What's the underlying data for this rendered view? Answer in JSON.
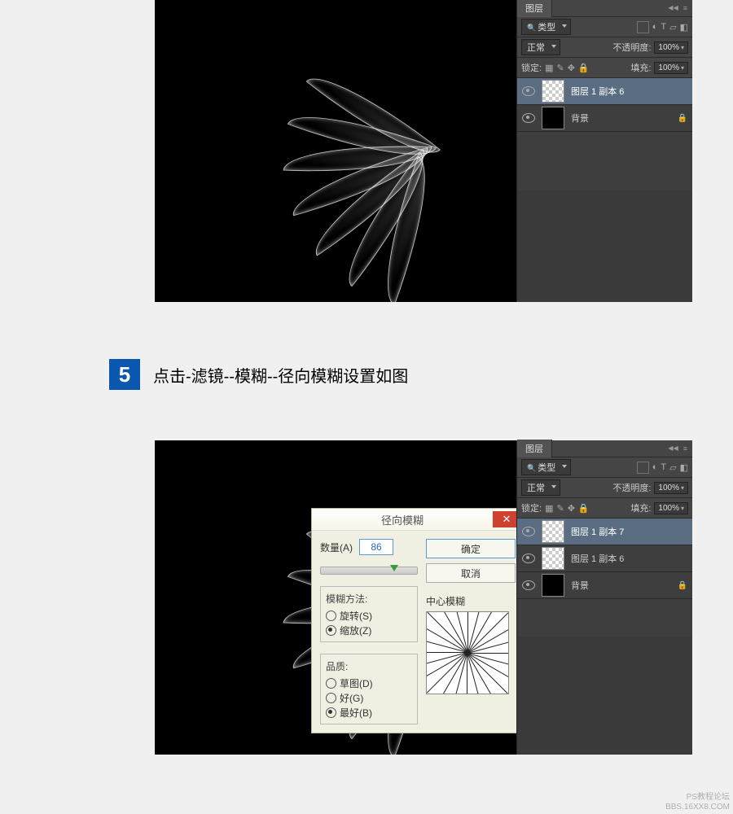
{
  "step": {
    "number": "5",
    "text": "点击-滤镜--模糊--径向模糊设置如图"
  },
  "panel1": {
    "tab": "图层",
    "filter": "类型",
    "blend": "正常",
    "opacityLabel": "不透明度:",
    "opacityValue": "100%",
    "lockLabel": "锁定:",
    "fillLabel": "填充:",
    "fillValue": "100%",
    "layers": [
      {
        "name": "图层 1 副本 6",
        "active": true,
        "thumb": "checker"
      },
      {
        "name": "背景",
        "active": false,
        "thumb": "black",
        "locked": true
      }
    ]
  },
  "panel2": {
    "tab": "图层",
    "filter": "类型",
    "blend": "正常",
    "opacityLabel": "不透明度:",
    "opacityValue": "100%",
    "lockLabel": "锁定:",
    "fillLabel": "填充:",
    "fillValue": "100%",
    "layers": [
      {
        "name": "图层 1 副本 7",
        "active": true,
        "thumb": "checker"
      },
      {
        "name": "图层 1 副本 6",
        "active": false,
        "thumb": "checker"
      },
      {
        "name": "背景",
        "active": false,
        "thumb": "black",
        "locked": true
      }
    ]
  },
  "dialog": {
    "title": "径向模糊",
    "ok": "确定",
    "cancel": "取消",
    "amountLabel": "数量(A)",
    "amountValue": "86",
    "methodLegend": "模糊方法:",
    "methodSpin": "旋转(S)",
    "methodZoom": "缩放(Z)",
    "qualityLegend": "品质:",
    "qualityDraft": "草图(D)",
    "qualityGood": "好(G)",
    "qualityBest": "最好(B)",
    "centerLabel": "中心模糊"
  },
  "watermark": {
    "line1": "PS教程论坛",
    "line2": "BBS.16XX8.COM"
  }
}
